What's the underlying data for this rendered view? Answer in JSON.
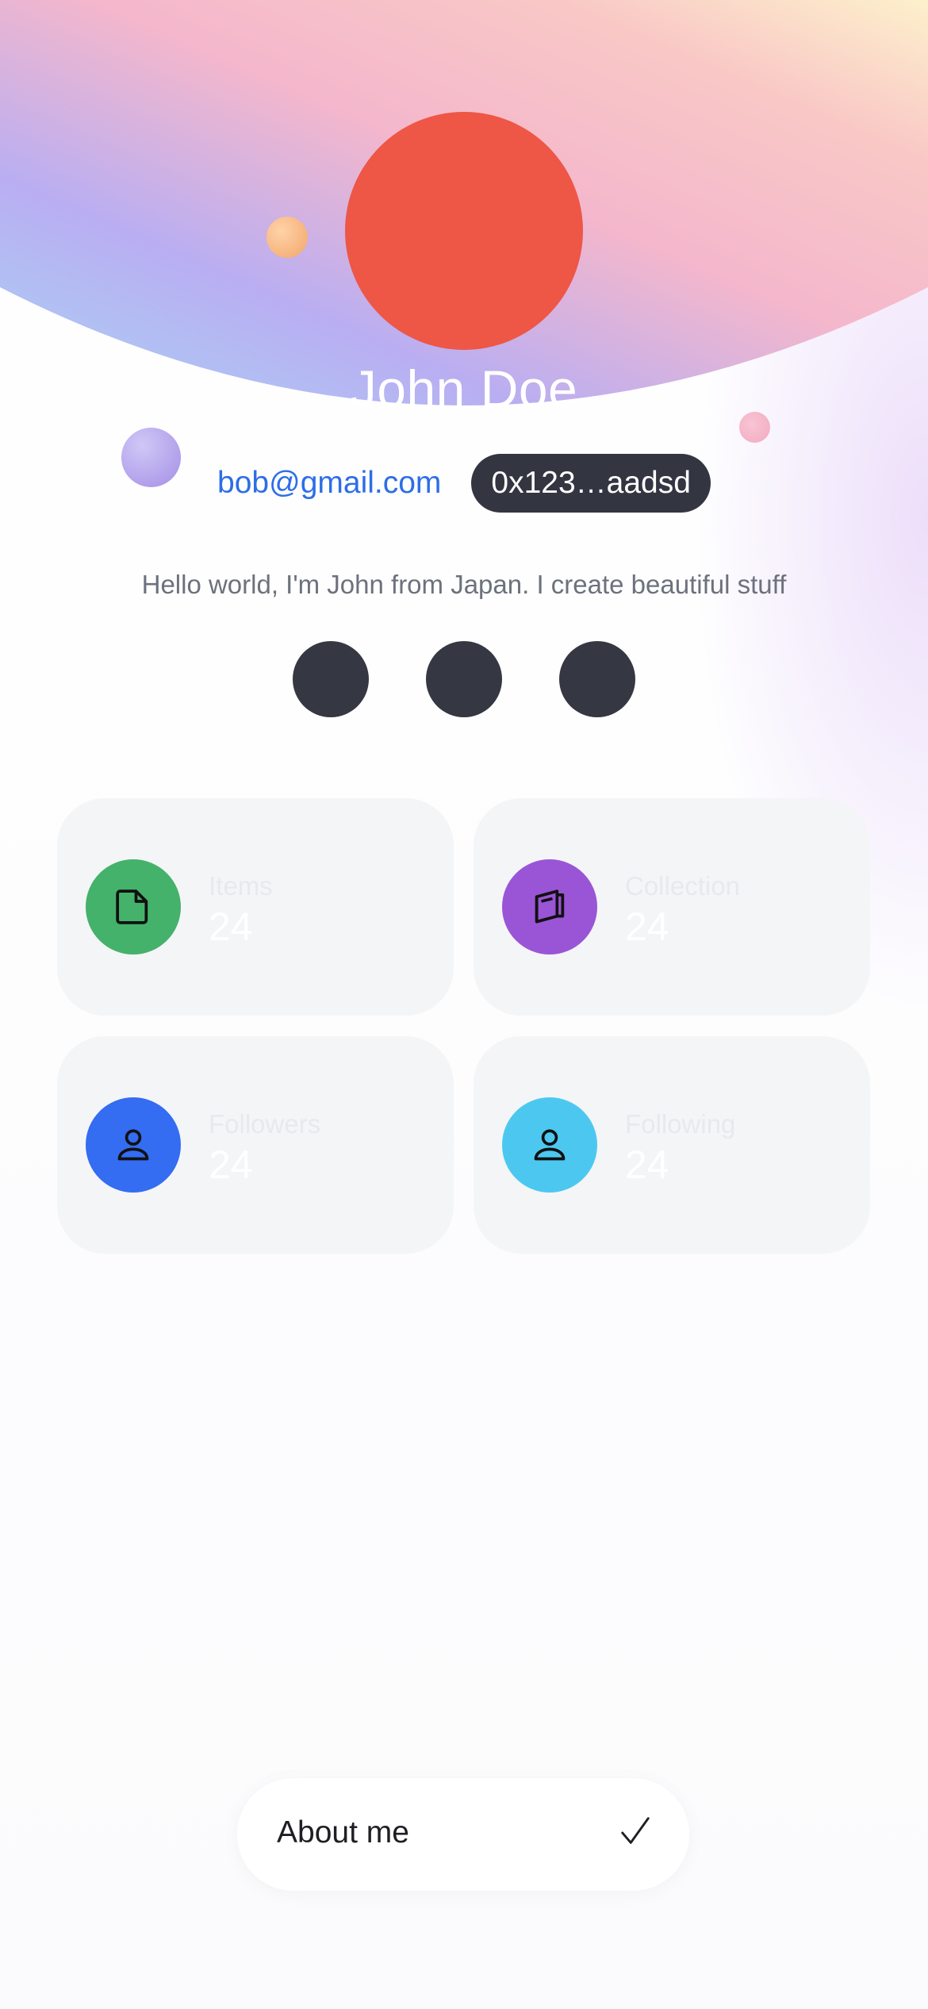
{
  "profile": {
    "name": "John Doe",
    "email": "bob@gmail.com",
    "wallet": "0x123…aadsd",
    "bio": "Hello world, I'm John from Japan. I create beautiful stuff",
    "avatar_color": "#ee5646"
  },
  "socials": [
    {
      "icon": "social-icon"
    },
    {
      "icon": "social-icon"
    },
    {
      "icon": "social-icon"
    }
  ],
  "stats": [
    {
      "label": "Items",
      "value": "24",
      "icon": "document-icon",
      "color": "#44b26a"
    },
    {
      "label": "Collection",
      "value": "24",
      "icon": "book-icon",
      "color": "#9a55d6"
    },
    {
      "label": "Followers",
      "value": "24",
      "icon": "user-icon",
      "color": "#346cf2"
    },
    {
      "label": "Following",
      "value": "24",
      "icon": "user-icon",
      "color": "#4cc8f0"
    }
  ],
  "tab_bar": {
    "about_label": "About me",
    "icon": "check-icon"
  },
  "colors": {
    "accent_link": "#2d6ee6",
    "dark_pill": "#333641"
  }
}
